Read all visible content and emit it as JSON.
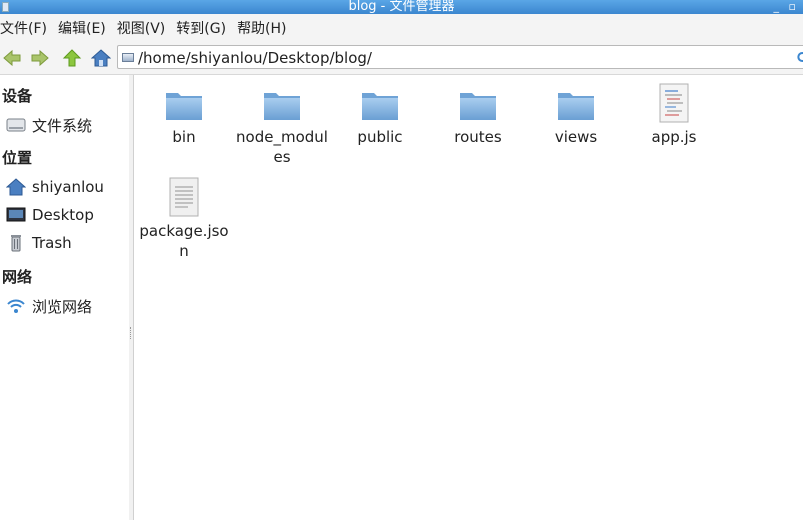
{
  "window": {
    "title": "blog - 文件管理器",
    "controls": "_ ▫"
  },
  "menubar": {
    "items": [
      "文件(F)",
      "编辑(E)",
      "视图(V)",
      "转到(G)",
      "帮助(H)"
    ]
  },
  "toolbar": {
    "location_path": "/home/shiyanlou/Desktop/blog/"
  },
  "sidebar": {
    "sections": [
      {
        "header": "设备",
        "items": [
          {
            "label": "文件系统",
            "icon": "drive-icon"
          }
        ]
      },
      {
        "header": "位置",
        "items": [
          {
            "label": "shiyanlou",
            "icon": "home-icon"
          },
          {
            "label": "Desktop",
            "icon": "desktop-icon"
          },
          {
            "label": "Trash",
            "icon": "trash-icon"
          }
        ]
      },
      {
        "header": "网络",
        "items": [
          {
            "label": "浏览网络",
            "icon": "network-icon"
          }
        ]
      }
    ]
  },
  "files": [
    {
      "name": "bin",
      "type": "folder"
    },
    {
      "name": "node_modules",
      "type": "folder"
    },
    {
      "name": "public",
      "type": "folder"
    },
    {
      "name": "routes",
      "type": "folder"
    },
    {
      "name": "views",
      "type": "folder"
    },
    {
      "name": "app.js",
      "type": "script"
    },
    {
      "name": "package.json",
      "type": "text"
    }
  ],
  "colors": {
    "titlebar": "#3b86cf",
    "folder": "#7fb1de",
    "accent_green": "#7ab800"
  }
}
